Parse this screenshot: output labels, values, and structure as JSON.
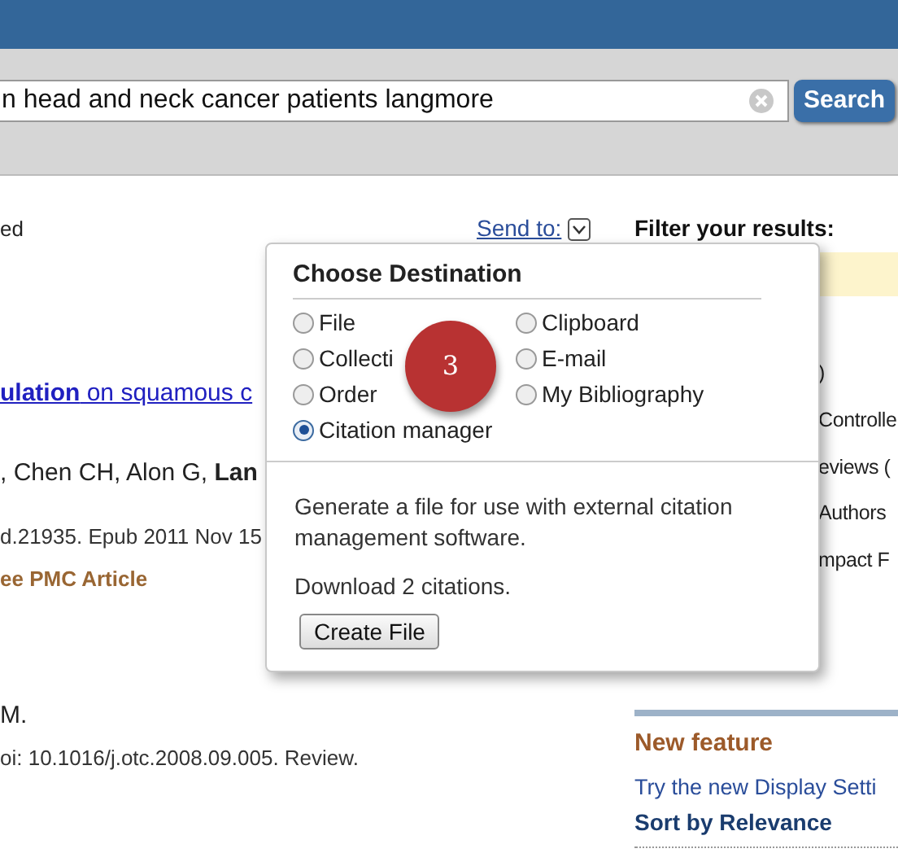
{
  "search": {
    "value": "n head and neck cancer patients langmore",
    "button": "Search"
  },
  "results": {
    "status": "ed",
    "send_to": "Send to:",
    "lines": [
      {
        "kind": "title",
        "text": "**ulation** on squamous c"
      },
      {
        "kind": "authors",
        "text": ", Chen CH, Alon G, **Lan**"
      },
      {
        "kind": "citation",
        "text": "d.21935. Epub 2011 Nov 15"
      },
      {
        "kind": "pmc",
        "text": "ee PMC Article"
      },
      {
        "kind": "authors",
        "text": "M."
      },
      {
        "kind": "citation",
        "text": "oi: 10.1016/j.otc.2008.09.005. Review."
      }
    ]
  },
  "filter": {
    "title": "Filter your results:",
    "items": [
      ")",
      "Controlle",
      "eviews (",
      "Authors",
      "mpact F"
    ]
  },
  "new_feature": {
    "title": "New feature",
    "text": "Try the new Display Setti",
    "sort": "Sort by Relevance"
  },
  "popup": {
    "title": "Choose Destination",
    "options": [
      {
        "label": "File",
        "selected": false
      },
      {
        "label": "Clipboard",
        "selected": false
      },
      {
        "label": "Collecti",
        "selected": false
      },
      {
        "label": "E-mail",
        "selected": false
      },
      {
        "label": "Order",
        "selected": false
      },
      {
        "label": "My Bibliography",
        "selected": false
      },
      {
        "label": "Citation manager",
        "selected": true
      }
    ],
    "description": "Generate a file for use with external citation management software.",
    "download": "Download 2 citations.",
    "button": "Create File",
    "badge": "3"
  }
}
